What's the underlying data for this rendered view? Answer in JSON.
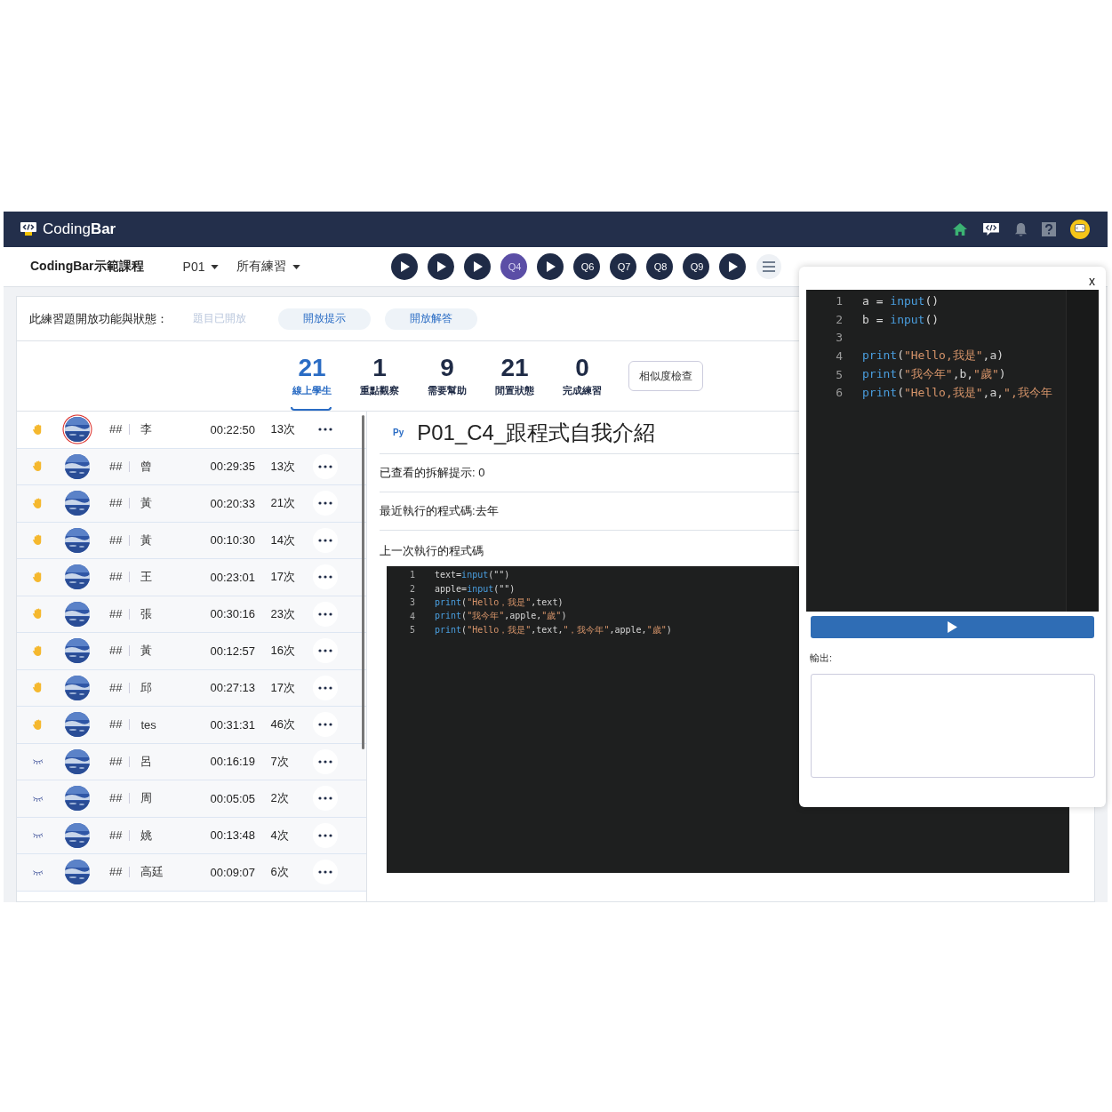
{
  "header": {
    "brand": "Coding**Bar**"
  },
  "toolbar": {
    "course": "CodingBar示範課程",
    "dropdowns": [
      "P01",
      "所有練習"
    ],
    "questions": [
      {
        "kind": "play",
        "selected": false
      },
      {
        "kind": "play",
        "selected": false
      },
      {
        "kind": "play",
        "selected": false
      },
      {
        "kind": "q",
        "label": "Q4",
        "selected": true
      },
      {
        "kind": "play",
        "selected": false
      },
      {
        "kind": "q",
        "label": "Q6",
        "selected": false
      },
      {
        "kind": "q",
        "label": "Q7",
        "selected": false
      },
      {
        "kind": "q",
        "label": "Q8",
        "selected": false
      },
      {
        "kind": "q",
        "label": "Q9",
        "selected": false
      },
      {
        "kind": "play",
        "selected": false
      }
    ]
  },
  "status": {
    "label": "此練習題開放功能與狀態：",
    "items": [
      {
        "label": "題目已開放",
        "disabled": true
      },
      {
        "label": "開放提示",
        "disabled": false
      },
      {
        "label": "開放解答",
        "disabled": false
      }
    ]
  },
  "stats": [
    {
      "value": "21",
      "label": "線上學生",
      "selected": true
    },
    {
      "value": "1",
      "label": "重點觀察",
      "selected": false
    },
    {
      "value": "9",
      "label": "需要幫助",
      "selected": false
    },
    {
      "value": "21",
      "label": "閒置狀態",
      "selected": false
    },
    {
      "value": "0",
      "label": "完成練習",
      "selected": false
    }
  ],
  "similarity_button": "相似度檢查",
  "students": [
    {
      "kind": "hand",
      "selected": true,
      "seat": "##",
      "name": "李",
      "time": "00:22:50",
      "runs": "13次"
    },
    {
      "kind": "hand",
      "selected": false,
      "seat": "##",
      "name": "曾",
      "time": "00:29:35",
      "runs": "13次"
    },
    {
      "kind": "hand",
      "selected": false,
      "seat": "##",
      "name": "黃",
      "time": "00:20:33",
      "runs": "21次"
    },
    {
      "kind": "hand",
      "selected": false,
      "seat": "##",
      "name": "黃",
      "time": "00:10:30",
      "runs": "14次"
    },
    {
      "kind": "hand",
      "selected": false,
      "seat": "##",
      "name": "王",
      "time": "00:23:01",
      "runs": "17次"
    },
    {
      "kind": "hand",
      "selected": false,
      "seat": "##",
      "name": "張",
      "time": "00:30:16",
      "runs": "23次"
    },
    {
      "kind": "hand",
      "selected": false,
      "seat": "##",
      "name": "黃",
      "time": "00:12:57",
      "runs": "16次"
    },
    {
      "kind": "hand",
      "selected": false,
      "seat": "##",
      "name": "邱",
      "time": "00:27:13",
      "runs": "17次"
    },
    {
      "kind": "hand",
      "selected": false,
      "seat": "##",
      "name": "tes",
      "time": "00:31:31",
      "runs": "46次"
    },
    {
      "kind": "idle",
      "selected": false,
      "seat": "##",
      "name": "呂",
      "time": "00:16:19",
      "runs": "7次"
    },
    {
      "kind": "idle",
      "selected": false,
      "seat": "##",
      "name": "周",
      "time": "00:05:05",
      "runs": "2次"
    },
    {
      "kind": "idle",
      "selected": false,
      "seat": "##",
      "name": "姚",
      "time": "00:13:48",
      "runs": "4次"
    },
    {
      "kind": "idle",
      "selected": false,
      "seat": "##",
      "name": "高廷",
      "time": "00:09:07",
      "runs": "6次"
    }
  ],
  "detail": {
    "lang": "Py",
    "title": "P01_C4_跟程式自我介紹",
    "hints_viewed": "已查看的拆解提示: 0",
    "recent_run": "最近執行的程式碼:去年",
    "last_code_label": "上一次執行的程式碼",
    "code": [
      {
        "num": "1",
        "tokens": [
          {
            "kind": "plain",
            "text": "text="
          },
          {
            "kind": "kw",
            "text": "input"
          },
          {
            "kind": "plain",
            "text": "(\"\")"
          }
        ]
      },
      {
        "num": "2",
        "tokens": [
          {
            "kind": "plain",
            "text": "apple="
          },
          {
            "kind": "kw",
            "text": "input"
          },
          {
            "kind": "plain",
            "text": "(\"\")"
          }
        ]
      },
      {
        "num": "3",
        "tokens": [
          {
            "kind": "kw",
            "text": "print"
          },
          {
            "kind": "plain",
            "text": "("
          },
          {
            "kind": "str",
            "text": "\"Hello，我是\""
          },
          {
            "kind": "plain",
            "text": ",text)"
          }
        ]
      },
      {
        "num": "4",
        "tokens": [
          {
            "kind": "kw",
            "text": "print"
          },
          {
            "kind": "plain",
            "text": "("
          },
          {
            "kind": "str",
            "text": "\"我今年\""
          },
          {
            "kind": "plain",
            "text": ",apple,"
          },
          {
            "kind": "str",
            "text": "\"歲\""
          },
          {
            "kind": "plain",
            "text": ")"
          }
        ]
      },
      {
        "num": "5",
        "tokens": [
          {
            "kind": "kw",
            "text": "print"
          },
          {
            "kind": "plain",
            "text": "("
          },
          {
            "kind": "str",
            "text": "\"Hello，我是\""
          },
          {
            "kind": "plain",
            "text": ",text,"
          },
          {
            "kind": "str",
            "text": "\"，我今年\""
          },
          {
            "kind": "plain",
            "text": ",apple,"
          },
          {
            "kind": "str",
            "text": "\"歲\""
          },
          {
            "kind": "plain",
            "text": ")"
          }
        ]
      }
    ]
  },
  "popup": {
    "close": "x",
    "output_label": "輸出:",
    "code": [
      {
        "num": "1",
        "tokens": [
          {
            "kind": "plain",
            "text": "a = "
          },
          {
            "kind": "kw",
            "text": "input"
          },
          {
            "kind": "plain",
            "text": "()"
          }
        ]
      },
      {
        "num": "2",
        "tokens": [
          {
            "kind": "plain",
            "text": "b = "
          },
          {
            "kind": "kw",
            "text": "input"
          },
          {
            "kind": "plain",
            "text": "()"
          }
        ]
      },
      {
        "num": "3"
      },
      {
        "num": "4",
        "tokens": [
          {
            "kind": "kw",
            "text": "print"
          },
          {
            "kind": "plain",
            "text": "("
          },
          {
            "kind": "str",
            "text": "\"Hello,我是\""
          },
          {
            "kind": "plain",
            "text": ",a)"
          }
        ]
      },
      {
        "num": "5",
        "tokens": [
          {
            "kind": "kw",
            "text": "print"
          },
          {
            "kind": "plain",
            "text": "("
          },
          {
            "kind": "str",
            "text": "\"我今年\""
          },
          {
            "kind": "plain",
            "text": ",b,"
          },
          {
            "kind": "str",
            "text": "\"歲\""
          },
          {
            "kind": "plain",
            "text": ")"
          }
        ]
      },
      {
        "num": "6",
        "tokens": [
          {
            "kind": "kw",
            "text": "print"
          },
          {
            "kind": "plain",
            "text": "("
          },
          {
            "kind": "str",
            "text": "\"Hello,我是\""
          },
          {
            "kind": "plain",
            "text": ",a,"
          },
          {
            "kind": "str",
            "text": "\",我今年"
          }
        ]
      }
    ]
  }
}
